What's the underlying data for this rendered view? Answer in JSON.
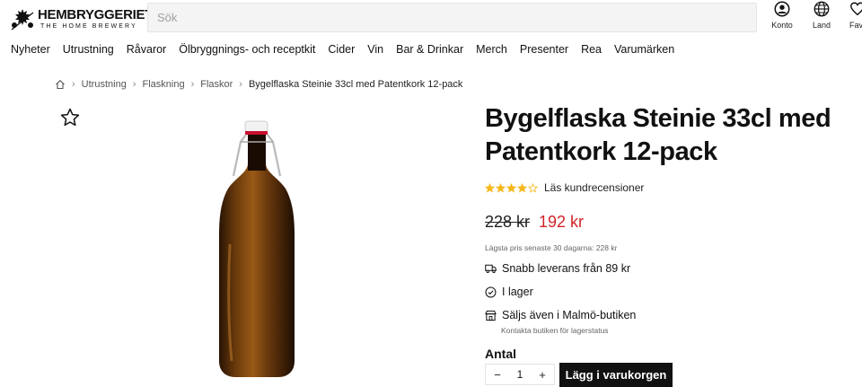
{
  "header": {
    "logo_name": "HEMBRYGGERIET",
    "logo_sub": "THE HOME BREWERY",
    "search_placeholder": "Sök",
    "account_label": "Konto",
    "country_label": "Land",
    "favorites_label": "Fav",
    "icons": {
      "account": "user-circle-icon",
      "country": "globe-icon",
      "favorites": "heart-icon"
    }
  },
  "nav": {
    "items": [
      "Nyheter",
      "Utrustning",
      "Råvaror",
      "Ölbryggnings- och receptkit",
      "Cider",
      "Vin",
      "Bar & Drinkar",
      "Merch",
      "Presenter",
      "Rea",
      "Varumärken"
    ]
  },
  "breadcrumb": {
    "home_icon": "home-icon",
    "items": [
      "Utrustning",
      "Flaskning",
      "Flaskor"
    ],
    "current": "Bygelflaska Steinie 33cl med Patentkork 12-pack"
  },
  "product": {
    "title": "Bygelflaska Steinie 33cl med Patentkork 12-pack",
    "rating": 4,
    "rating_max": 5,
    "reviews_label": "Läs kundrecensioner",
    "old_price": "228 kr",
    "new_price": "192 kr",
    "lowest_price_note": "Lägsta pris senaste 30 dagarna: 228 kr",
    "delivery": "Snabb leverans från 89 kr",
    "stock": "I lager",
    "store": "Säljs även i Malmö-butiken",
    "store_sub": "Kontakta butiken för lagerstatus",
    "qty_label": "Antal",
    "qty_value": "1",
    "qty_minus": "−",
    "qty_plus": "+",
    "add_to_cart": "Lägg i varukorgen"
  },
  "colors": {
    "sale_red": "#d2232a",
    "star_gold": "#f5b81c",
    "button_black": "#111111"
  }
}
